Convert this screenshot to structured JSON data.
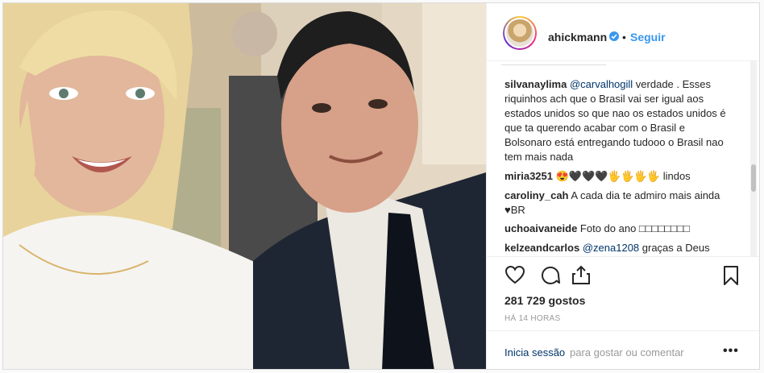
{
  "header": {
    "username": "ahickmann",
    "separator": "•",
    "follow_label": "Seguir"
  },
  "comments": [
    {
      "user": "silvanaylima",
      "mention": "@carvalhogill",
      "text": " verdade . Esses riquinhos ach que o Brasil vai ser igual aos estados unidos so que nao os estados unidos é que ta querendo acabar com o Brasil e Bolsonaro está entregando tudooo o Brasil nao tem mais nada"
    },
    {
      "user": "miria3251",
      "mention": "",
      "text": " 😍🖤🖤🖤🖐🖐🖐🖐 lindos"
    },
    {
      "user": "caroliny_cah",
      "mention": "",
      "text": " A cada dia te admiro mais ainda ♥BR"
    },
    {
      "user": "uchoaivaneide",
      "mention": "",
      "text": " Foto do ano □□□□□□□□"
    },
    {
      "user": "kelzeandcarlos",
      "mention": "@zena1208",
      "text": " graças a Deus"
    }
  ],
  "actions": {
    "like_icon": "heart-icon",
    "comment_icon": "comment-icon",
    "share_icon": "share-icon",
    "save_icon": "bookmark-icon",
    "likes_text": "281 729 gostos",
    "time_text": "HÁ 14 HORAS"
  },
  "footer": {
    "login_link": "Inicia sessão",
    "login_rest": "para gostar ou comentar",
    "more_label": "•••"
  },
  "colors": {
    "link_blue": "#3897f0",
    "dark_link": "#003569",
    "text": "#262626",
    "muted": "#999999"
  }
}
